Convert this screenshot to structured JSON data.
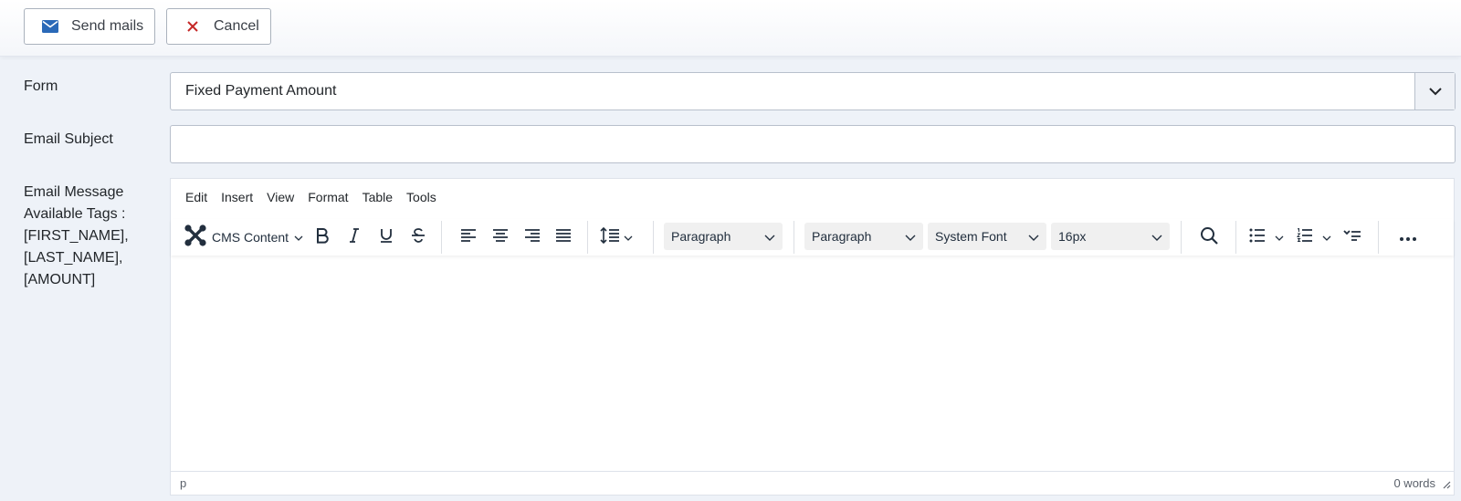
{
  "toolbar": {
    "send_label": "Send mails",
    "cancel_label": "Cancel"
  },
  "form": {
    "form_label": "Form",
    "form_selected": "Fixed Payment Amount",
    "subject_label": "Email Subject",
    "subject_value": "",
    "message_label_lines": [
      "Email Message",
      "Available Tags :",
      "[FIRST_NAME],",
      "[LAST_NAME],",
      "[AMOUNT]"
    ]
  },
  "editor": {
    "menu": [
      "Edit",
      "Insert",
      "View",
      "Format",
      "Table",
      "Tools"
    ],
    "cms_content_label": "CMS Content",
    "block_format": "Paragraph",
    "style_format": "Paragraph",
    "font_family": "System Font",
    "font_size": "16px",
    "status_path": "p",
    "word_count": "0 words"
  },
  "colors": {
    "send_icon": "#2a69b8",
    "cancel_icon": "#c52827",
    "background": "#eef2f8"
  }
}
